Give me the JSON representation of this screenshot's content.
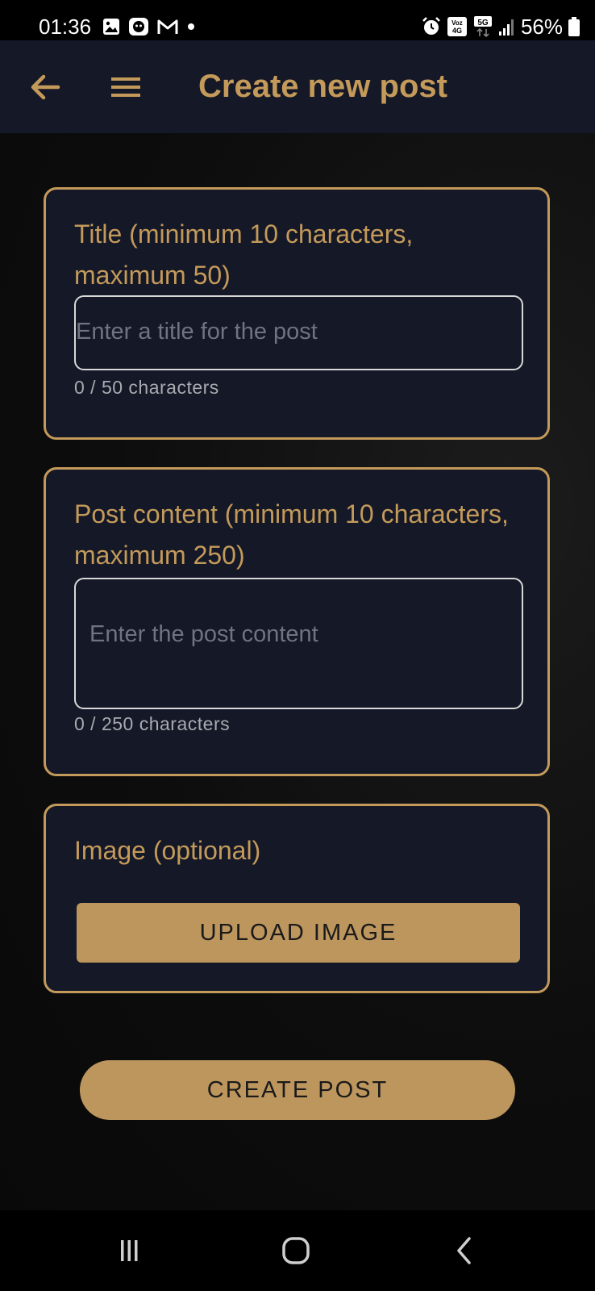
{
  "status_bar": {
    "time": "01:36",
    "battery_text": "56%",
    "network_label_volte": "Voz 4G",
    "network_label_5g": "5G",
    "left_icons": [
      "gallery-icon",
      "app-badge-icon",
      "gmail-icon",
      "dot-icon"
    ],
    "right_icons": [
      "alarm-icon",
      "volte-icon",
      "5g-data-icon",
      "signal-icon",
      "battery-icon"
    ]
  },
  "app_bar": {
    "title": "Create new post",
    "back_icon": "arrow-left-icon",
    "menu_icon": "hamburger-menu-icon"
  },
  "form": {
    "title_field": {
      "label": "Title (minimum 10 characters, maximum 50)",
      "placeholder": "Enter a title for the post",
      "value": "",
      "counter": "0 / 50 characters"
    },
    "content_field": {
      "label": "Post content (minimum 10 characters, maximum 250)",
      "placeholder": "Enter the post content",
      "value": "",
      "counter": "0 / 250 characters"
    },
    "image_field": {
      "label": "Image (optional)",
      "upload_button": "UPLOAD IMAGE"
    },
    "submit_button": "CREATE POST"
  },
  "nav_bar": {
    "icons": [
      "recent-apps-icon",
      "home-icon",
      "back-nav-icon"
    ]
  },
  "colors": {
    "accent": "#c49a5a",
    "button": "#bd965e",
    "card_bg": "#141827",
    "app_bar_bg": "#141827",
    "placeholder": "#6f7480",
    "counter": "#a9abb0"
  }
}
